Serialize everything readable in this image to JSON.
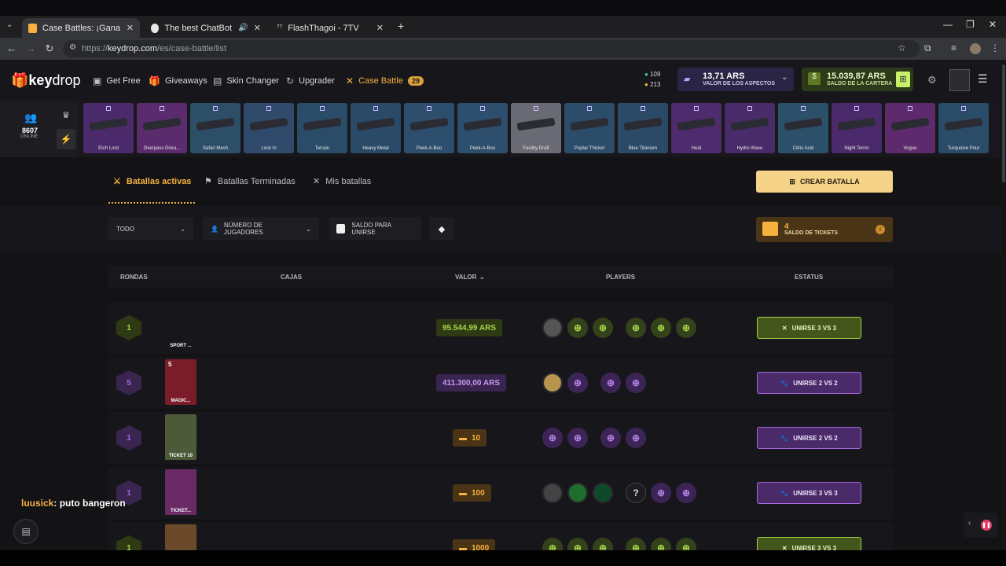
{
  "browser": {
    "tabs": [
      {
        "title": "Case Battles: ¡Gana Skins Épicos",
        "active": true
      },
      {
        "title": "The best ChatBot and Widg",
        "active": false
      },
      {
        "title": "FlashThagoi - 7TV",
        "active": false
      }
    ],
    "new_tab": "+",
    "url_prefix": "https://",
    "url_host": "keydrop.com",
    "url_path": "/es/case-battle/list"
  },
  "site": {
    "logo_a": "key",
    "logo_b": "drop",
    "nav": [
      "Get Free",
      "Giveaways",
      "Skin Changer",
      "Upgrader",
      "Case Battle"
    ],
    "case_battle_badge": "29",
    "gems": "109",
    "coins": "213",
    "inventory_value": "13,71 ARS",
    "inventory_label": "VALOR DE LOS ASPECTOS",
    "wallet_value": "15.039,87 ARS",
    "wallet_label": "SALDO DE LA CARTERA"
  },
  "ticker": {
    "online_count": "8607",
    "online_label": "ONLINE",
    "drops": [
      {
        "name": "Etch Lord",
        "color": "#4b2a6b"
      },
      {
        "name": "Overpass Diora...",
        "color": "#5a2c6e"
      },
      {
        "name": "Safari Mesh",
        "color": "#2c4e66"
      },
      {
        "name": "Lock In",
        "color": "#2f4a6a"
      },
      {
        "name": "Terrain",
        "color": "#2a4c69"
      },
      {
        "name": "Heavy Metal",
        "color": "#2b4a67"
      },
      {
        "name": "Peek-A-Boo",
        "color": "#2d4e6c"
      },
      {
        "name": "Peek-A-Boo",
        "color": "#2d4e6c"
      },
      {
        "name": "Facility Draft",
        "color": "#6a6a74"
      },
      {
        "name": "Poplar Thicket",
        "color": "#2b4d6a"
      },
      {
        "name": "Blue Titanium",
        "color": "#2b4a68"
      },
      {
        "name": "Heat",
        "color": "#4d2b6c"
      },
      {
        "name": "Hydro Wave",
        "color": "#4a2b6a"
      },
      {
        "name": "Citric Acid",
        "color": "#2c4f6a"
      },
      {
        "name": "Night Terror",
        "color": "#4a2a6a"
      },
      {
        "name": "Vogue",
        "color": "#5d2a6d"
      },
      {
        "name": "Turquoise Pour",
        "color": "#2b4c68"
      }
    ]
  },
  "battles_nav": {
    "active": "Batallas activas",
    "finished": "Batallas Terminadas",
    "mine": "Mis batallas",
    "create": "CREAR BATALLA"
  },
  "filters": {
    "all": "TODO",
    "players": "NÚMERO DE JUGADORES",
    "balance": "SALDO PARA UNIRSE",
    "tickets_count": "4",
    "tickets_label": "SALDO DE TICKETS"
  },
  "table": {
    "headers": [
      "RONDAS",
      "CAJAS",
      "VALOR",
      "PLAYERS",
      "ESTATUS"
    ],
    "rows": [
      {
        "rounds": "1",
        "case": "SPORT ...",
        "case_count": "",
        "price": "95.544,99 ARS",
        "theme": "green",
        "join": "UNIRSE 3 VS 3"
      },
      {
        "rounds": "5",
        "case": "MAGIC...",
        "case_count": "5",
        "price": "411.300,00 ARS",
        "theme": "purple",
        "join": "UNIRSE 2 VS 2"
      },
      {
        "rounds": "1",
        "case": "TICKET 10",
        "case_count": "",
        "price": "10",
        "theme": "purple",
        "join": "UNIRSE 2 VS 2"
      },
      {
        "rounds": "1",
        "case": "TICKET...",
        "case_count": "",
        "price": "100",
        "theme": "purple",
        "join": "UNIRSE 3 VS 3"
      },
      {
        "rounds": "1",
        "case": "",
        "case_count": "",
        "price": "1000",
        "theme": "green",
        "join": "UNIRSE 3 VS 3"
      }
    ]
  },
  "chat": {
    "user": "luusick",
    "message": ": puto bangeron"
  }
}
